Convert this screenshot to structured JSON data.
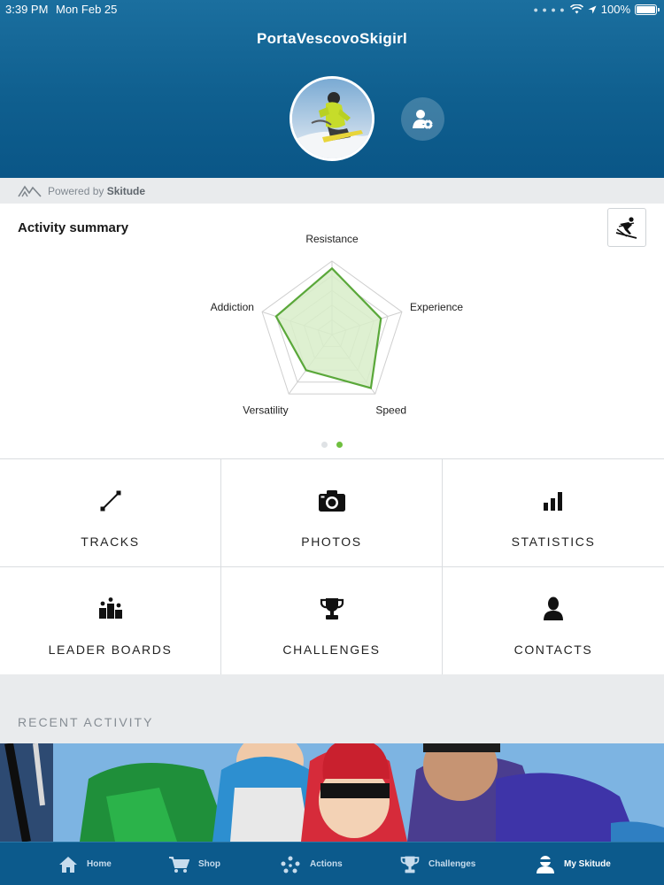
{
  "status_bar": {
    "time": "3:39 PM",
    "date": "Mon Feb 25",
    "battery": "100%"
  },
  "profile": {
    "username": "PortaVescovoSkigirl"
  },
  "powered": {
    "prefix": "Powered by",
    "brand": "Skitude"
  },
  "summary": {
    "title": "Activity summary",
    "chart_data": {
      "type": "radar",
      "axes": [
        "Resistance",
        "Experience",
        "Speed",
        "Versatility",
        "Addiction"
      ],
      "scale_max": 5,
      "values": [
        4.5,
        3.5,
        4.5,
        3.0,
        4.0
      ],
      "grid_levels": 5,
      "colors": {
        "line": "#5aa83a",
        "fill": "#d8edc9",
        "grid": "#cfcfcf"
      }
    },
    "pages": 2,
    "active_page": 1
  },
  "menu": [
    {
      "label": "TRACKS",
      "icon": "route-icon"
    },
    {
      "label": "PHOTOS",
      "icon": "camera-icon"
    },
    {
      "label": "STATISTICS",
      "icon": "bar-chart-icon"
    },
    {
      "label": "LEADER BOARDS",
      "icon": "podium-icon"
    },
    {
      "label": "CHALLENGES",
      "icon": "trophy-icon"
    },
    {
      "label": "CONTACTS",
      "icon": "person-icon"
    }
  ],
  "recent": {
    "title": "RECENT ACTIVITY"
  },
  "tabbar": [
    {
      "label": "Home",
      "icon": "home-icon",
      "active": false
    },
    {
      "label": "Shop",
      "icon": "cart-icon",
      "active": false
    },
    {
      "label": "Actions",
      "icon": "actions-icon",
      "active": false
    },
    {
      "label": "Challenges",
      "icon": "trophy-icon",
      "active": false
    },
    {
      "label": "My Skitude",
      "icon": "skier-profile-icon",
      "active": true
    }
  ],
  "colors": {
    "header": "#0f5f8f",
    "accent": "#6fbf3f",
    "tabbar": "#0c5a8c"
  }
}
